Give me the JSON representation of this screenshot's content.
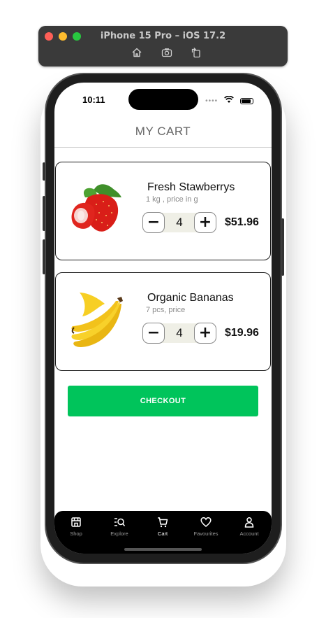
{
  "simulator": {
    "title": "iPhone 15 Pro – iOS 17.2",
    "tools": [
      "home-icon",
      "screenshot-icon",
      "rotate-icon"
    ]
  },
  "status_bar": {
    "time": "10:11",
    "signal": "••••"
  },
  "header": {
    "title": "MY CART"
  },
  "cart": {
    "items": [
      {
        "name": "Fresh Stawberrys",
        "description": "1 kg , price in g",
        "quantity": "4",
        "price": "$51.96",
        "image": "strawberry-image"
      },
      {
        "name": "Organic Bananas",
        "description": "7 pcs, price",
        "quantity": "4",
        "price": "$19.96",
        "image": "banana-image"
      }
    ],
    "minus_label": "−",
    "plus_label": "+"
  },
  "checkout": {
    "label": "CHECKOUT",
    "color": "#00c45b"
  },
  "tab_bar": {
    "tabs": [
      {
        "label": "Shop",
        "icon": "shop-icon"
      },
      {
        "label": "Explore",
        "icon": "explore-icon"
      },
      {
        "label": "Cart",
        "icon": "cart-icon",
        "active": true
      },
      {
        "label": "Favourites",
        "icon": "heart-icon"
      },
      {
        "label": "Account",
        "icon": "account-icon"
      }
    ]
  }
}
